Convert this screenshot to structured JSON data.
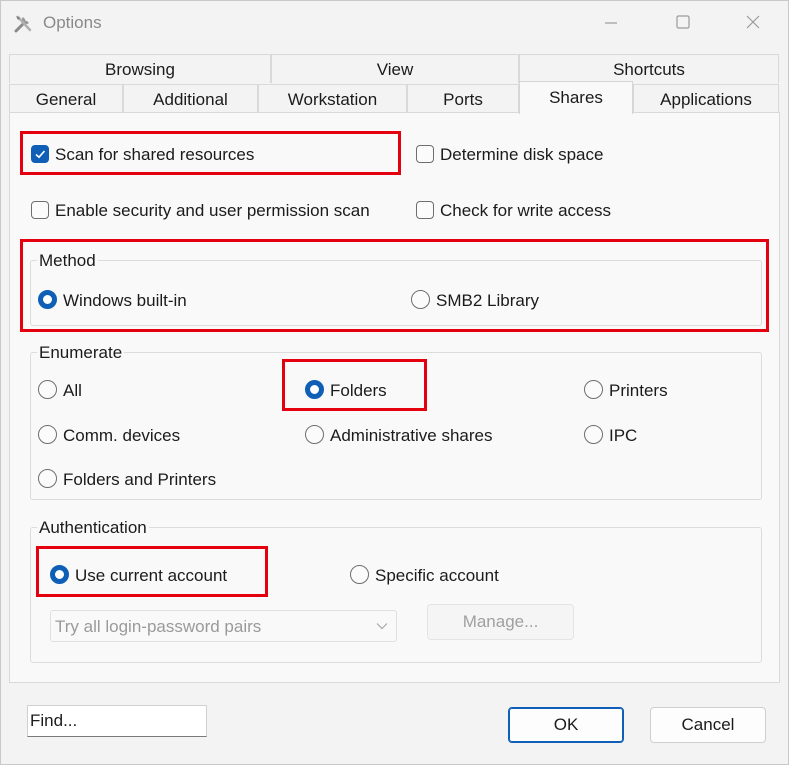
{
  "window": {
    "title": "Options"
  },
  "tabs": {
    "row_top": [
      "Browsing",
      "View",
      "Shortcuts"
    ],
    "row_bottom": [
      "General",
      "Additional",
      "Workstation",
      "Ports",
      "Shares",
      "Applications"
    ],
    "active": "Shares"
  },
  "options": {
    "scan_shared": {
      "label": "Scan for shared resources",
      "checked": true
    },
    "disk_space": {
      "label": "Determine disk space",
      "checked": false
    },
    "security_scan": {
      "label": "Enable security and user permission scan",
      "checked": false
    },
    "write_access": {
      "label": "Check for write access",
      "checked": false
    }
  },
  "method": {
    "title": "Method",
    "options": [
      "Windows built-in",
      "SMB2 Library"
    ],
    "selected": "Windows built-in"
  },
  "enumerate": {
    "title": "Enumerate",
    "options": [
      "All",
      "Folders",
      "Printers",
      "Comm. devices",
      "Administrative shares",
      "IPC",
      "Folders and Printers"
    ],
    "selected": "Folders"
  },
  "authentication": {
    "title": "Authentication",
    "options": [
      "Use current account",
      "Specific account"
    ],
    "selected": "Use current account",
    "combo_value": "Try all login-password pairs",
    "manage_label": "Manage..."
  },
  "footer": {
    "find_placeholder": "Find...",
    "ok_label": "OK",
    "cancel_label": "Cancel"
  },
  "colors": {
    "accent": "#0f5fb7",
    "highlight": "#e4000f"
  }
}
